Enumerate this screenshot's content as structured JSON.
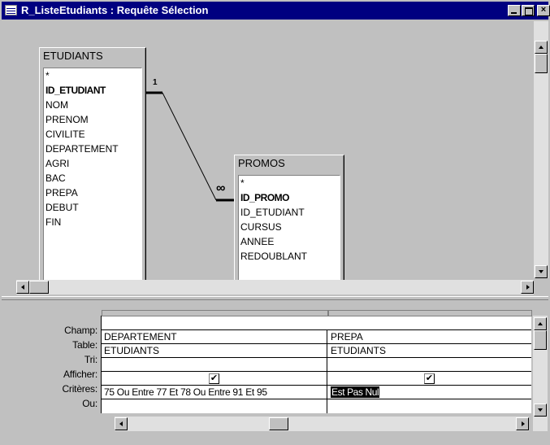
{
  "window": {
    "title": "R_ListeEtudiants : Requête Sélection",
    "icon": "query-datasheet-icon",
    "controls": {
      "minimize": "minimize-icon",
      "maximize": "maximize-icon",
      "close": "close-icon"
    }
  },
  "diagram": {
    "tables": [
      {
        "name": "ETUDIANTS",
        "fields": [
          "*",
          "ID_ETUDIANT",
          "NOM",
          "PRENOM",
          "CIVILITE",
          "DEPARTEMENT",
          "AGRI",
          "BAC",
          "PREPA",
          "DEBUT",
          "FIN"
        ],
        "key_fields": [
          "ID_ETUDIANT"
        ]
      },
      {
        "name": "PROMOS",
        "fields": [
          "*",
          "ID_PROMO",
          "ID_ETUDIANT",
          "CURSUS",
          "ANNEE",
          "REDOUBLANT"
        ],
        "key_fields": [
          "ID_PROMO"
        ]
      }
    ],
    "relationship": {
      "from": "ETUDIANTS.ID_ETUDIANT",
      "to": "PROMOS.ID_ETUDIANT",
      "one_label": "1",
      "many_label": "∞"
    }
  },
  "grid": {
    "row_labels": {
      "field": "Champ:",
      "table": "Table:",
      "sort": "Tri:",
      "show": "Afficher:",
      "criteria": "Critères:",
      "or": "Ou:"
    },
    "columns": [
      {
        "field": "DEPARTEMENT",
        "table": "ETUDIANTS",
        "sort": "",
        "show": true,
        "criteria": "75 Ou Entre 77 Et 78 Ou Entre 91 Et 95",
        "or": ""
      },
      {
        "field": "PREPA",
        "table": "ETUDIANTS",
        "sort": "",
        "show": true,
        "criteria": "Est Pas Nul",
        "or": ""
      }
    ],
    "check_glyph": "✔"
  },
  "colors": {
    "titlebar": "#000080",
    "face": "#c0c0c0",
    "selection": "#000000"
  }
}
